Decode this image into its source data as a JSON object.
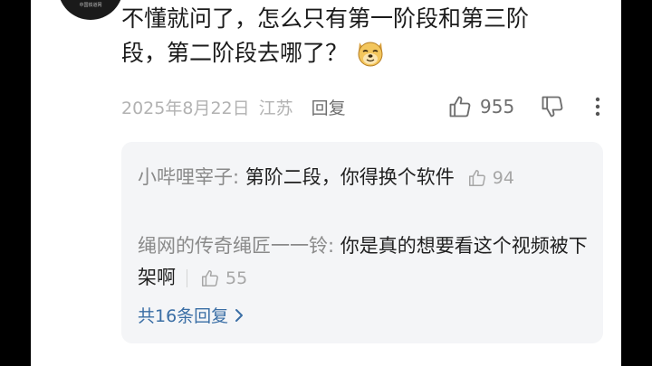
{
  "avatar": {
    "text": "中国铁道网"
  },
  "comment": {
    "text": "不懂就问了，怎么只有第一阶段和第三阶段，第二阶段去哪了？",
    "emoji": "doge-emoji"
  },
  "meta": {
    "date": "2025年8月22日",
    "location": "江苏",
    "reply_label": "回复",
    "like_count": "955"
  },
  "replies": [
    {
      "user": "小哔哩宰子",
      "separator": ": ",
      "text": "第阶二段，你得换个软件",
      "likes": "94"
    },
    {
      "user": "绳网的传奇绳匠一一铃",
      "separator": ": ",
      "text": "你是真的想要看这个视频被下架啊",
      "likes": "55"
    }
  ],
  "more_replies": {
    "label": "共16条回复"
  },
  "colors": {
    "link": "#3a6ea5",
    "muted": "#b2b2b2",
    "reply_bg": "#f4f5f7"
  }
}
